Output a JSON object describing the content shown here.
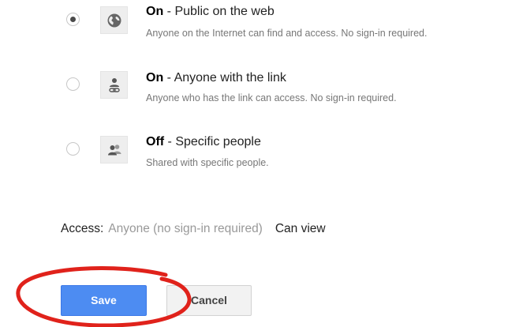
{
  "sharing_options": [
    {
      "status": "On",
      "separator": " - ",
      "title": "Public on the web",
      "description": "Anyone on the Internet can find and access. No sign-in required.",
      "icon": "globe-icon",
      "selected": true
    },
    {
      "status": "On",
      "separator": " - ",
      "title": "Anyone with the link",
      "description": "Anyone who has the link can access. No sign-in required.",
      "icon": "person-link-icon",
      "selected": false
    },
    {
      "status": "Off",
      "separator": " - ",
      "title": "Specific people",
      "description": "Shared with specific people.",
      "icon": "people-icon",
      "selected": false
    }
  ],
  "access": {
    "label": "Access:",
    "value": "Anyone (no sign-in required)",
    "permission": "Can view"
  },
  "buttons": {
    "save_label": "Save",
    "cancel_label": "Cancel"
  },
  "annotation": {
    "shape": "ellipse",
    "target": "save-button",
    "color": "#e0221b"
  },
  "colors": {
    "primary_button": "#4d8cf2",
    "secondary_button": "#f2f2f2",
    "annotation": "#e0221b"
  }
}
